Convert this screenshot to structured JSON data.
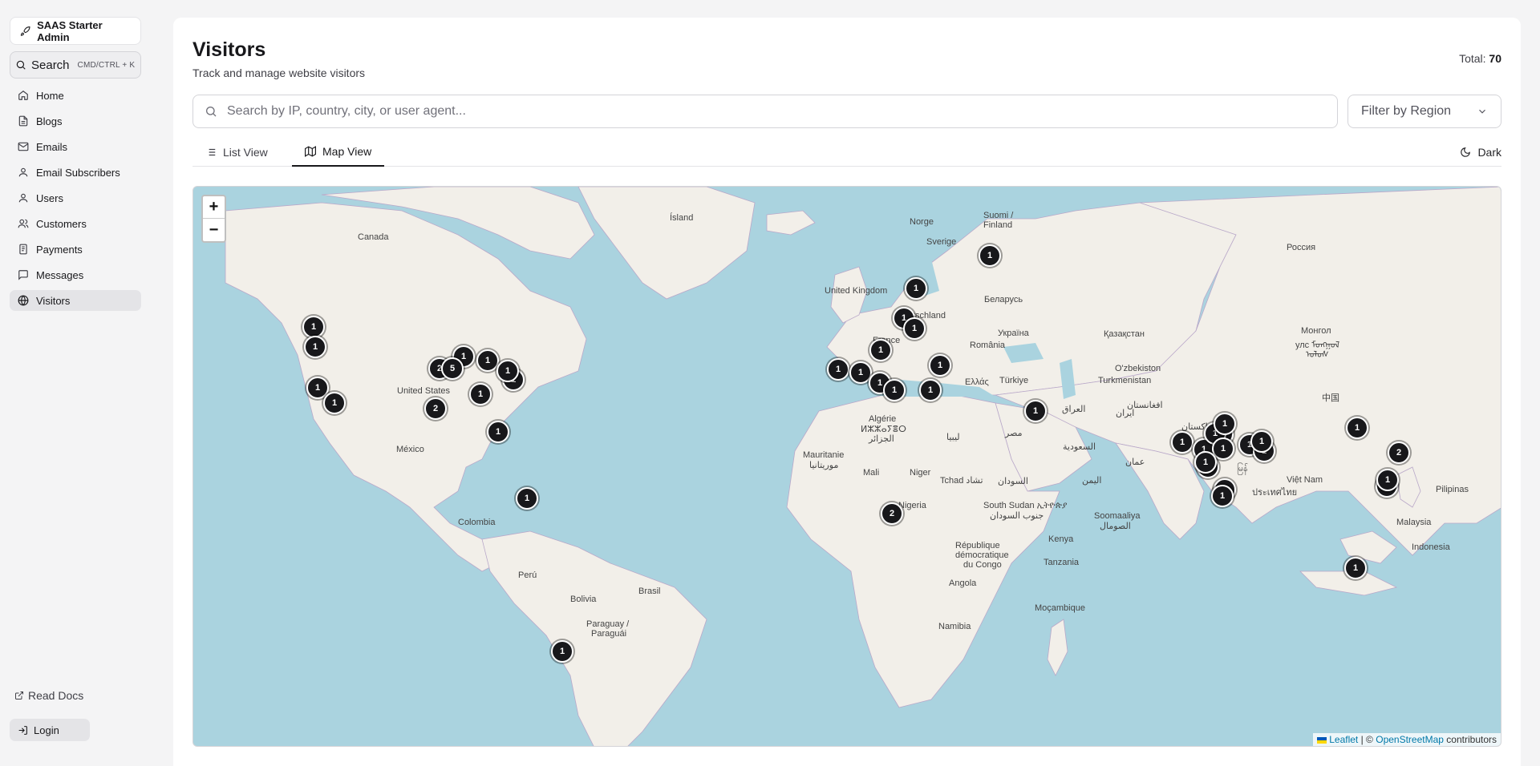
{
  "sidebar": {
    "brand": "SAAS Starter Admin",
    "search_label": "Search",
    "search_shortcut": "CMD/CTRL + K",
    "items": [
      {
        "label": "Home",
        "icon": "home-icon"
      },
      {
        "label": "Blogs",
        "icon": "file-icon"
      },
      {
        "label": "Emails",
        "icon": "mail-icon"
      },
      {
        "label": "Email Subscribers",
        "icon": "user-icon"
      },
      {
        "label": "Users",
        "icon": "user-icon"
      },
      {
        "label": "Customers",
        "icon": "users-icon"
      },
      {
        "label": "Payments",
        "icon": "credit-card-icon"
      },
      {
        "label": "Messages",
        "icon": "message-icon"
      },
      {
        "label": "Visitors",
        "icon": "globe-icon",
        "active": true
      }
    ],
    "read_docs": "Read Docs",
    "login": "Login"
  },
  "header": {
    "title": "Visitors",
    "subtitle": "Track and manage website visitors",
    "total_label": "Total:",
    "total_value": "70"
  },
  "search": {
    "placeholder": "Search by IP, country, city, or user agent...",
    "value": ""
  },
  "filter": {
    "selected": "Filter by Region"
  },
  "tabs": [
    {
      "label": "List View",
      "icon": "list-icon",
      "active": false
    },
    {
      "label": "Map View",
      "icon": "map-icon",
      "active": true
    }
  ],
  "theme_toggle": "Dark",
  "map": {
    "zoom_in": "+",
    "zoom_out": "−",
    "attribution": {
      "leaflet": "Leaflet",
      "sep": "| ©",
      "osm": "OpenStreetMap",
      "suffix": "contributors"
    },
    "labels": {
      "island": "Ísland",
      "canada": "Canada",
      "norge": "Norge",
      "sverige": "Sverige",
      "suomi1": "Suomi /",
      "suomi2": "Finland",
      "rossiya": "Россия",
      "uk": "United Kingdom",
      "belarus": "Беларусь",
      "deutschland": "tschland",
      "ukraina": "Україна",
      "france": "France",
      "romania": "România",
      "kazakhstan": "Қазақстан",
      "mongol1": "Монгол",
      "mongol2": "улс ᠮᠣᠩᠭᠣᠯ",
      "mongol3": "ᠤᠯᠤᠰ",
      "ozbekiston": "O'zbekiston",
      "turkmenistan": "Turkmenistan",
      "turkiye": "Türkiye",
      "ellas": "Ελλάς",
      "usa": "United States",
      "zhongguo": "中国",
      "afghanistan": "افغانستان",
      "iraq": "العراق",
      "iran": "ایران",
      "pakistan": "پاکستان",
      "algerie1": "Algérie",
      "algerie2": "ⵍⵣⵣⴰⵢⴻⵔ",
      "algerie3": "الجزائر",
      "libya": "ليبيا",
      "misr": "مصر",
      "saudi": "السعودية",
      "oman": "عمان",
      "mexico": "México",
      "mauritanie1": "Mauritanie",
      "mauritanie2": "موريتانيا",
      "mali": "Mali",
      "niger": "Niger",
      "tchad": "Tchad تشاد",
      "sudan": "السودان",
      "yemen": "اليمن",
      "vietnam": "Việt Nam",
      "thailand": "ประเทศไทย",
      "myanmar": "မြန်",
      "philippines": "Pilipinas",
      "nigeria": "Nigeria",
      "ssudan1": "South Sudan ኢትዮጵያ",
      "ssudan2": "جنوب السودان",
      "somaliland1": "Soomaaliya",
      "somaliland2": "الصومال",
      "malaysia": "Malaysia",
      "colombia": "Colombia",
      "rdc1": "République",
      "rdc2": "démocratique",
      "rdc3": "du Congo",
      "kenya": "Kenya",
      "tanzania": "Tanzania",
      "indonesia": "Indonesia",
      "peru": "Perú",
      "brasil": "Brasil",
      "angola": "Angola",
      "bolivia": "Bolivia",
      "mocambique": "Moçambique",
      "paraguay1": "Paraguay /",
      "paraguay2": "Paraguái",
      "namibia": "Namibia"
    },
    "clusters": [
      "1",
      "1",
      "1",
      "1",
      "1",
      "1",
      "1",
      "1",
      "1",
      "1",
      "1",
      "1",
      "1",
      "1",
      "1",
      "1",
      "1",
      "1",
      "1",
      "1",
      "1",
      "2",
      "2",
      "2",
      "2",
      "5",
      "1",
      "1",
      "1",
      "1",
      "1",
      "1",
      "1",
      "1",
      "1",
      "1",
      "1",
      "1",
      "1",
      "1",
      "1",
      "1",
      "1",
      "1",
      "1",
      "1"
    ]
  }
}
